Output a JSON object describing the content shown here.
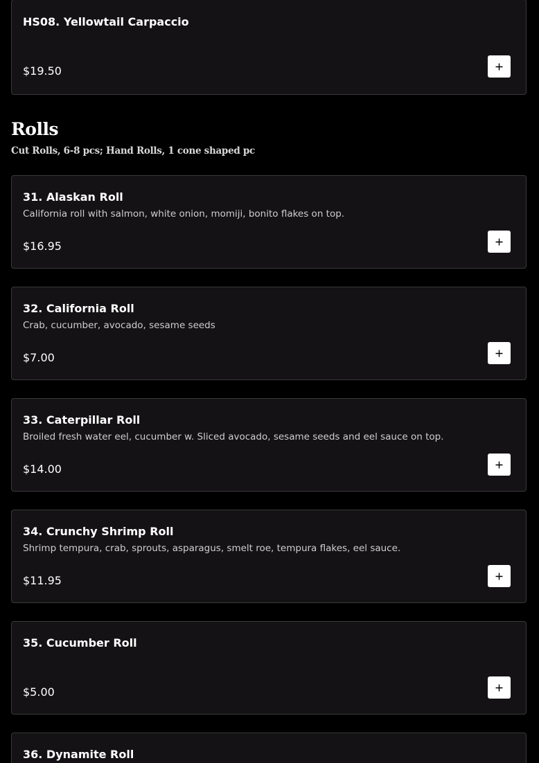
{
  "add_icon": "plus-icon",
  "colors": {
    "page_background": "#000000",
    "card_background": "#141214",
    "card_border": "#3a3a3a",
    "button_background": "#ffffff",
    "text_primary": "#ffffff",
    "text_secondary": "#cfcfcf"
  },
  "previous_item": {
    "name": "HS08. Yellowtail Carpaccio",
    "description": "",
    "price": "$19.50"
  },
  "section": {
    "title": "Rolls",
    "subtitle": "Cut Rolls, 6-8 pcs; Hand Rolls, 1 cone shaped pc",
    "items": [
      {
        "name": "31. Alaskan Roll",
        "description": "California roll with salmon, white onion, momiji, bonito flakes on top.",
        "price": "$16.95"
      },
      {
        "name": "32. California Roll",
        "description": "Crab, cucumber, avocado, sesame seeds",
        "price": "$7.00"
      },
      {
        "name": "33. Caterpillar Roll",
        "description": "Broiled fresh water eel, cucumber w. Sliced avocado, sesame seeds and eel sauce on top.",
        "price": "$14.00"
      },
      {
        "name": "34. Crunchy Shrimp Roll",
        "description": "Shrimp tempura, crab, sprouts, asparagus, smelt roe, tempura flakes, eel sauce.",
        "price": "$11.95"
      },
      {
        "name": "35. Cucumber Roll",
        "description": "",
        "price": "$5.00"
      },
      {
        "name": "36. Dynamite Roll",
        "description": "",
        "price": ""
      }
    ]
  }
}
